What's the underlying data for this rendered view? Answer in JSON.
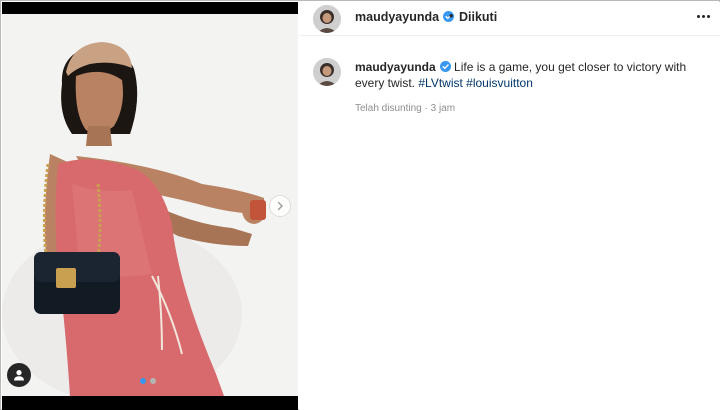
{
  "post": {
    "username": "maudyayunda",
    "follow_separator": "•",
    "follow_status": "Diikuti",
    "caption_text": "Life is a game, you get closer to victory with every twist.",
    "hashtags": [
      "#LVtwist",
      "#louisvuitton"
    ],
    "meta_edited": "Telah disunting",
    "meta_separator": "·",
    "meta_time": "3 jam"
  },
  "carousel": {
    "total_slides": 2,
    "active_slide": 1
  },
  "icons": {
    "verified": "verified-badge-icon",
    "more": "more-options-icon",
    "next": "chevron-right-icon",
    "tag": "user-tag-icon"
  },
  "colors": {
    "verified": "#3897f0",
    "hashtag": "#00376b",
    "meta": "#8e8e8e",
    "active_dot": "#3897f0"
  }
}
